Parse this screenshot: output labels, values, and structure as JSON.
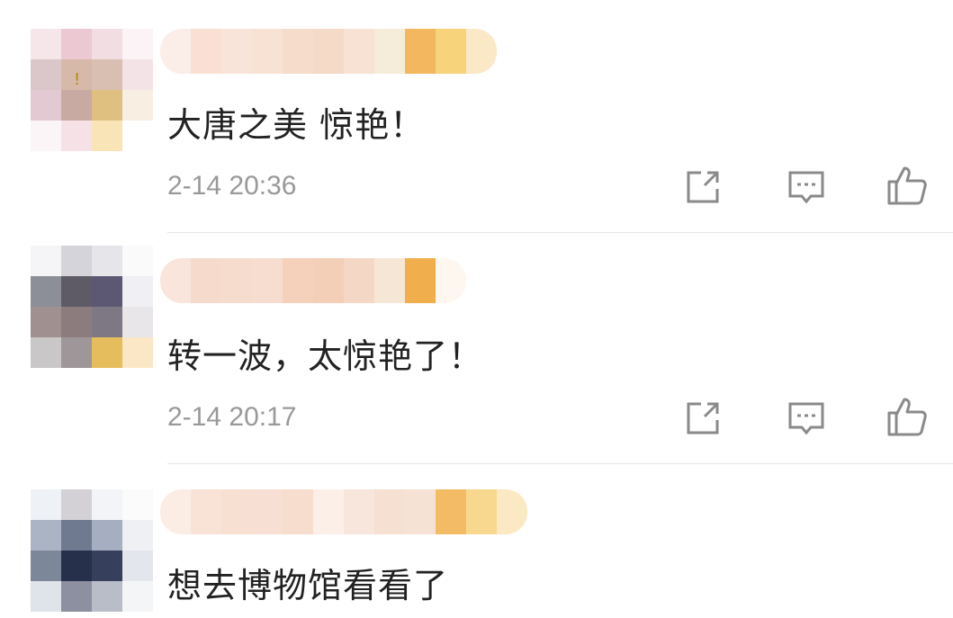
{
  "comments": [
    {
      "text": "大唐之美 惊艳！",
      "time": "2-14 20:36",
      "avatar_colors": [
        "#f6e6ea",
        "#ecc9d2",
        "#f2dde3",
        "#fbf3f5",
        "#dbc6ca",
        "#d6b9a8",
        "#d8bfb2",
        "#f3e3e6",
        "#e3cad2",
        "#c8aaa2",
        "#e0c080",
        "#f8efe2",
        "#fbf5f7",
        "#f6e1e6",
        "#f9e4b8",
        "#ffffff"
      ],
      "avatar_mark": "!",
      "name_colors": [
        "#fbeee8",
        "#f9e0d2",
        "#f8e4d8",
        "#f8e2d4",
        "#f6dccb",
        "#f6dac8",
        "#f7e2d4",
        "#f5ecd9",
        "#f3b85f",
        "#f7d37c",
        "#fbe8c6"
      ]
    },
    {
      "text": "转一波，太惊艳了！",
      "time": "2-14 20:17",
      "avatar_colors": [
        "#f5f5f7",
        "#d4d4da",
        "#e6e6ea",
        "#fafafa",
        "#8c8f98",
        "#5f5b66",
        "#5c5874",
        "#f0eff3",
        "#a09090",
        "#8c7c7e",
        "#7e7884",
        "#e8e6e8",
        "#cac7c8",
        "#9e9698",
        "#e6bd5c",
        "#fbe7c6"
      ],
      "avatar_mark": "",
      "name_colors": [
        "#f9e5dc",
        "#f6dacb",
        "#f6dccd",
        "#f7ddd0",
        "#f5d1bc",
        "#f3cfb8",
        "#f5d7c6",
        "#f6e6d6",
        "#f0ae4d",
        "#fdf7f0"
      ]
    },
    {
      "text": "想去博物馆看看了",
      "time": "",
      "avatar_colors": [
        "#eef1f6",
        "#d3d1d5",
        "#f3f4f7",
        "#fbfbfc",
        "#aab4c4",
        "#6f7a90",
        "#a6aec2",
        "#eef0f4",
        "#7c889a",
        "#26304a",
        "#363f5c",
        "#e3e6ec",
        "#dfe3ea",
        "#8c90a0",
        "#b9bdc8",
        "#f4f5f7"
      ],
      "avatar_mark": "",
      "name_colors": [
        "#fbece4",
        "#f9e2d6",
        "#f7dfd2",
        "#f7e0d3",
        "#f7ddce",
        "#fbefe8",
        "#f8e6dc",
        "#f6e0d2",
        "#f6e2d5",
        "#f2bb64",
        "#f8d88e",
        "#fbe9c4"
      ]
    }
  ],
  "icon_color": "#8a8a8a",
  "icons": [
    "share-icon",
    "comment-icon",
    "like-icon"
  ]
}
